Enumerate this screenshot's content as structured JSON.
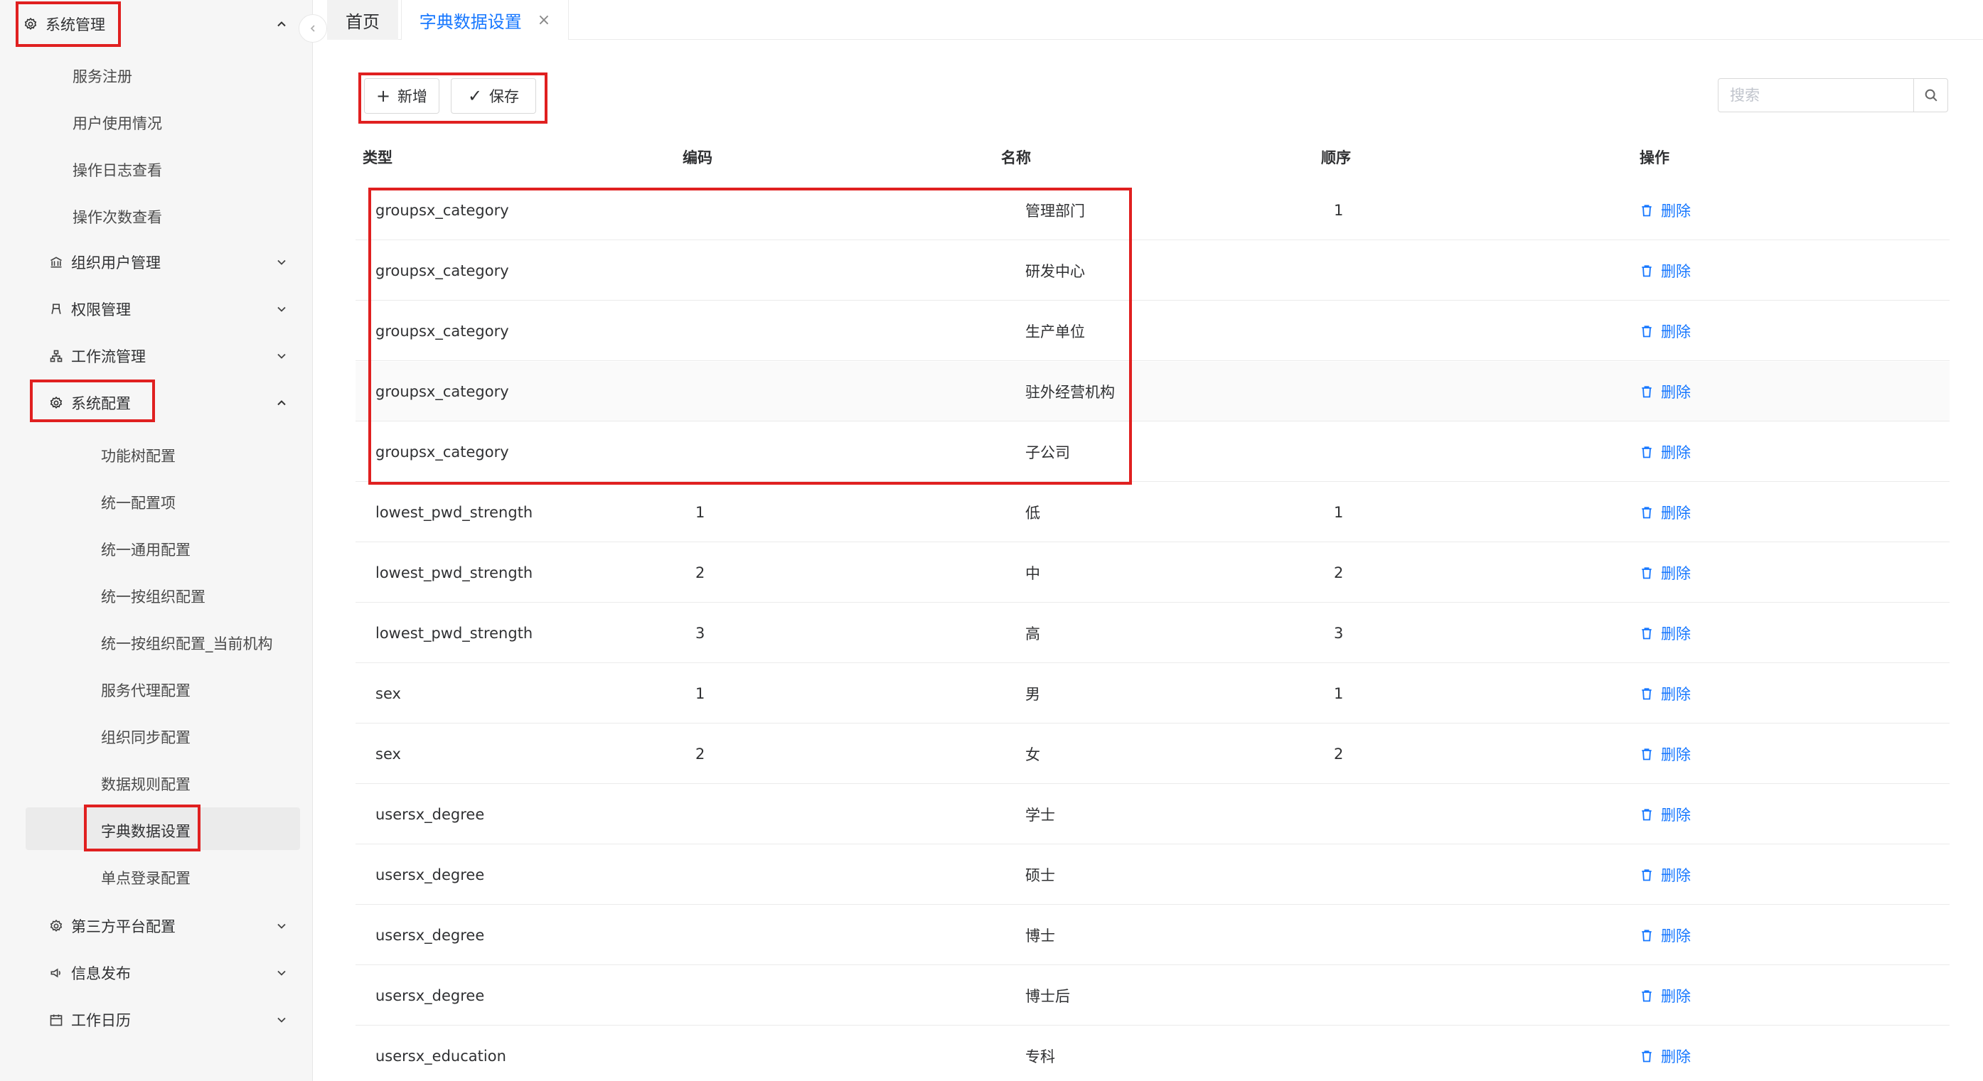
{
  "sidebar": {
    "group_system_mgmt": "系统管理",
    "system_mgmt_items": [
      "服务注册",
      "用户使用情况",
      "操作日志查看",
      "操作次数查看"
    ],
    "org_user_mgmt": "组织用户管理",
    "permission_mgmt": "权限管理",
    "workflow_mgmt": "工作流管理",
    "system_config": "系统配置",
    "system_config_items": [
      "功能树配置",
      "统一配置项",
      "统一通用配置",
      "统一按组织配置",
      "统一按组织配置_当前机构",
      "服务代理配置",
      "组织同步配置",
      "数据规则配置",
      "字典数据设置",
      "单点登录配置"
    ],
    "third_party_config": "第三方平台配置",
    "info_publish": "信息发布",
    "work_calendar": "工作日历"
  },
  "tabs": {
    "home": "首页",
    "active": "字典数据设置",
    "close_glyph": "×"
  },
  "toolbar": {
    "add_label": "新增",
    "save_label": "保存",
    "add_glyph": "+",
    "save_glyph": "✓",
    "search_placeholder": "搜索"
  },
  "table": {
    "headers": [
      "类型",
      "编码",
      "名称",
      "顺序",
      "操作"
    ],
    "delete_label": "删除",
    "rows": [
      {
        "type": "groupsx_category",
        "code": "",
        "name": "管理部门",
        "order": "1"
      },
      {
        "type": "groupsx_category",
        "code": "",
        "name": "研发中心",
        "order": ""
      },
      {
        "type": "groupsx_category",
        "code": "",
        "name": "生产单位",
        "order": ""
      },
      {
        "type": "groupsx_category",
        "code": "",
        "name": "驻外经营机构",
        "order": ""
      },
      {
        "type": "groupsx_category",
        "code": "",
        "name": "子公司",
        "order": ""
      },
      {
        "type": "lowest_pwd_strength",
        "code": "1",
        "name": "低",
        "order": "1"
      },
      {
        "type": "lowest_pwd_strength",
        "code": "2",
        "name": "中",
        "order": "2"
      },
      {
        "type": "lowest_pwd_strength",
        "code": "3",
        "name": "高",
        "order": "3"
      },
      {
        "type": "sex",
        "code": "1",
        "name": "男",
        "order": "1"
      },
      {
        "type": "sex",
        "code": "2",
        "name": "女",
        "order": "2"
      },
      {
        "type": "usersx_degree",
        "code": "",
        "name": "学士",
        "order": ""
      },
      {
        "type": "usersx_degree",
        "code": "",
        "name": "硕士",
        "order": ""
      },
      {
        "type": "usersx_degree",
        "code": "",
        "name": "博士",
        "order": ""
      },
      {
        "type": "usersx_degree",
        "code": "",
        "name": "博士后",
        "order": ""
      },
      {
        "type": "usersx_education",
        "code": "",
        "name": "专科",
        "order": ""
      }
    ]
  },
  "colors": {
    "accent": "#1677ff",
    "highlight": "#e02020"
  }
}
